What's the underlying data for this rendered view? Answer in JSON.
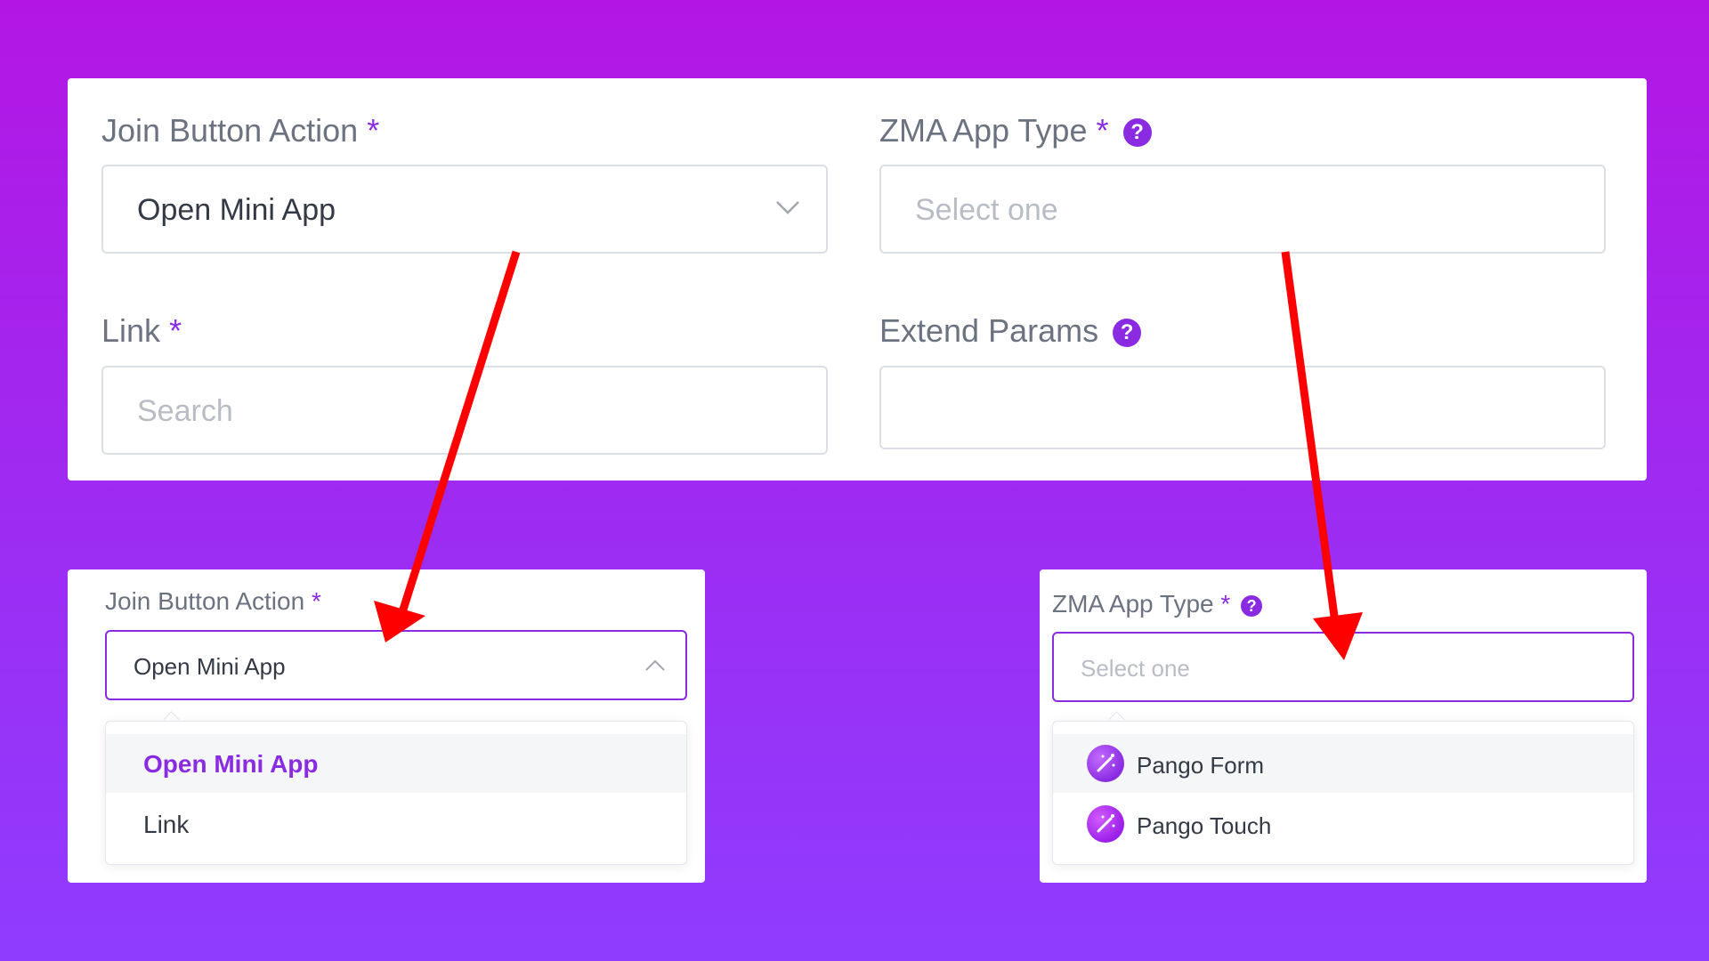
{
  "top": {
    "join_label": "Join Button Action",
    "required_mark": "*",
    "join_value": "Open Mini App",
    "zma_label": "ZMA App Type",
    "zma_placeholder": "Select one",
    "link_label": "Link",
    "link_placeholder": "Search",
    "extend_label": "Extend Params",
    "extend_value": "",
    "help_glyph": "?"
  },
  "left_dropdown": {
    "label": "Join Button Action",
    "required_mark": "*",
    "value": "Open Mini App",
    "options": [
      {
        "label": "Open Mini App",
        "selected": true
      },
      {
        "label": "Link",
        "selected": false
      }
    ]
  },
  "right_dropdown": {
    "label": "ZMA App Type",
    "required_mark": "*",
    "help_glyph": "?",
    "placeholder": "Select one",
    "options": [
      {
        "label": "Pango Form",
        "icon": "magic-wand-icon"
      },
      {
        "label": "Pango Touch",
        "icon": "magic-wand-icon"
      }
    ]
  },
  "colors": {
    "accent": "#8a2be2",
    "arrow": "#ff0000",
    "background_top": "#b316e4",
    "background_bottom": "#8f3cff"
  }
}
